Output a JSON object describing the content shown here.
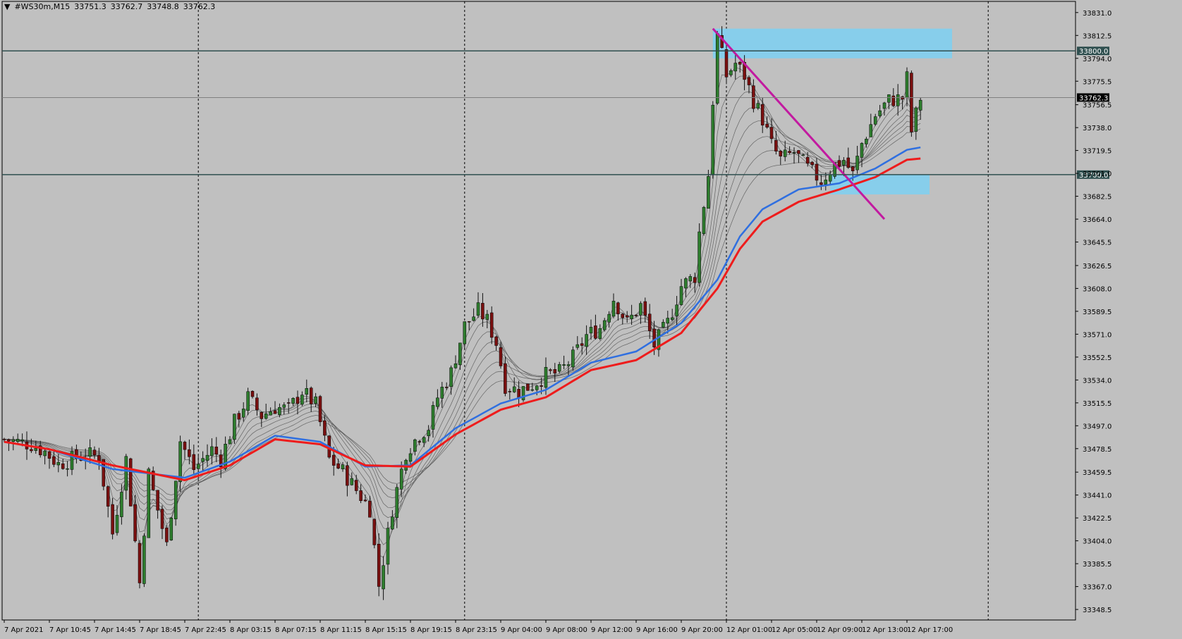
{
  "header": {
    "dropdown_icon": "triangle-down-icon",
    "symbol": "#WS30m,M15",
    "open": "33751.3",
    "high": "33762.7",
    "low": "33748.8",
    "close": "33762.3"
  },
  "colors": {
    "background": "#c0c0c0",
    "bull_candle": "#2e7d2e",
    "bear_candle": "#7a1010",
    "wick": "#111111",
    "ema_fast": "#2f6fe0",
    "ema_slow": "#ee1c1c",
    "ribbon": "#555555",
    "zone": "#87ceeb",
    "trendline": "#c21aa0",
    "hline": "#2f4f4f",
    "price_line": "#808080"
  },
  "chart_data": {
    "type": "candlestick",
    "symbol": "#WS30m",
    "timeframe": "M15",
    "ylim": [
      33340,
      33840
    ],
    "y_ticks": [
      "33831.0",
      "33812.5",
      "33794.0",
      "33775.5",
      "33756.5",
      "33738.0",
      "33719.5",
      "33701.0",
      "33682.5",
      "33664.0",
      "33645.5",
      "33626.5",
      "33608.0",
      "33589.5",
      "33571.0",
      "33552.5",
      "33534.0",
      "33515.5",
      "33497.0",
      "33478.5",
      "33459.5",
      "33441.0",
      "33422.5",
      "33404.0",
      "33385.5",
      "33367.0",
      "33348.5"
    ],
    "x_ticks": [
      "7 Apr 2021",
      "7 Apr 10:45",
      "7 Apr 14:45",
      "7 Apr 18:45",
      "7 Apr 22:45",
      "8 Apr 03:15",
      "8 Apr 07:15",
      "8 Apr 11:15",
      "8 Apr 15:15",
      "8 Apr 19:15",
      "8 Apr 23:15",
      "9 Apr 04:00",
      "9 Apr 08:00",
      "9 Apr 12:00",
      "9 Apr 16:00",
      "9 Apr 20:00",
      "12 Apr 01:00",
      "12 Apr 05:00",
      "12 Apr 09:00",
      "12 Apr 13:00",
      "12 Apr 17:00"
    ],
    "candles_count": 204,
    "close_path": [
      [
        0,
        33486
      ],
      [
        6,
        33482
      ],
      [
        9,
        33476
      ],
      [
        12,
        33466
      ],
      [
        18,
        33474
      ],
      [
        21,
        33472
      ],
      [
        24,
        33410
      ],
      [
        27,
        33470
      ],
      [
        30,
        33370
      ],
      [
        32,
        33458
      ],
      [
        36,
        33400
      ],
      [
        39,
        33485
      ],
      [
        42,
        33462
      ],
      [
        46,
        33478
      ],
      [
        48,
        33470
      ],
      [
        51,
        33500
      ],
      [
        54,
        33520
      ],
      [
        57,
        33505
      ],
      [
        60,
        33512
      ],
      [
        63,
        33510
      ],
      [
        66,
        33525
      ],
      [
        69,
        33514
      ],
      [
        72,
        33470
      ],
      [
        75,
        33460
      ],
      [
        78,
        33445
      ],
      [
        81,
        33430
      ],
      [
        83,
        33368
      ],
      [
        86,
        33430
      ],
      [
        89,
        33476
      ],
      [
        92,
        33490
      ],
      [
        94,
        33496
      ],
      [
        96,
        33520
      ],
      [
        99,
        33540
      ],
      [
        102,
        33578
      ],
      [
        105,
        33590
      ],
      [
        107,
        33582
      ],
      [
        109,
        33564
      ],
      [
        111,
        33530
      ],
      [
        114,
        33525
      ],
      [
        117,
        33530
      ],
      [
        120,
        33538
      ],
      [
        123,
        33540
      ],
      [
        126,
        33552
      ],
      [
        129,
        33570
      ],
      [
        132,
        33576
      ],
      [
        135,
        33600
      ],
      [
        138,
        33580
      ],
      [
        141,
        33594
      ],
      [
        144,
        33562
      ],
      [
        147,
        33580
      ],
      [
        150,
        33610
      ],
      [
        153,
        33618
      ],
      [
        154,
        33653
      ],
      [
        156,
        33700
      ],
      [
        157,
        33760
      ],
      [
        158,
        33812
      ],
      [
        160,
        33780
      ],
      [
        162,
        33790
      ],
      [
        164,
        33780
      ],
      [
        166,
        33760
      ],
      [
        168,
        33745
      ],
      [
        170,
        33724
      ],
      [
        172,
        33712
      ],
      [
        175,
        33718
      ],
      [
        178,
        33705
      ],
      [
        181,
        33695
      ],
      [
        184,
        33708
      ],
      [
        186,
        33712
      ],
      [
        188,
        33700
      ],
      [
        190,
        33725
      ],
      [
        193,
        33748
      ],
      [
        196,
        33760
      ],
      [
        199,
        33762
      ],
      [
        200,
        33778
      ],
      [
        201,
        33735
      ],
      [
        203,
        33762.3
      ]
    ],
    "ema_fast_path": [
      [
        0,
        33484
      ],
      [
        10,
        33478
      ],
      [
        24,
        33462
      ],
      [
        40,
        33455
      ],
      [
        50,
        33468
      ],
      [
        60,
        33489
      ],
      [
        70,
        33484
      ],
      [
        80,
        33464
      ],
      [
        90,
        33465
      ],
      [
        100,
        33495
      ],
      [
        110,
        33515
      ],
      [
        120,
        33526
      ],
      [
        130,
        33548
      ],
      [
        140,
        33557
      ],
      [
        150,
        33580
      ],
      [
        158,
        33615
      ],
      [
        163,
        33650
      ],
      [
        168,
        33672
      ],
      [
        176,
        33688
      ],
      [
        185,
        33693
      ],
      [
        193,
        33705
      ],
      [
        200,
        33720
      ],
      [
        203,
        33722
      ]
    ],
    "ema_slow_path": [
      [
        0,
        33484
      ],
      [
        10,
        33478
      ],
      [
        24,
        33465
      ],
      [
        40,
        33453
      ],
      [
        50,
        33465
      ],
      [
        60,
        33486
      ],
      [
        70,
        33482
      ],
      [
        80,
        33465
      ],
      [
        90,
        33464
      ],
      [
        100,
        33490
      ],
      [
        110,
        33510
      ],
      [
        120,
        33520
      ],
      [
        130,
        33542
      ],
      [
        140,
        33550
      ],
      [
        150,
        33572
      ],
      [
        158,
        33608
      ],
      [
        163,
        33640
      ],
      [
        168,
        33662
      ],
      [
        176,
        33678
      ],
      [
        185,
        33688
      ],
      [
        193,
        33698
      ],
      [
        200,
        33712
      ],
      [
        203,
        33713
      ]
    ],
    "horizontal_lines": [
      {
        "price": 33800.0,
        "label": "33800.0"
      },
      {
        "price": 33700.0,
        "label": "33700.0"
      }
    ],
    "current_price": {
      "price": 33762.3,
      "label": "33762.3"
    },
    "zones": [
      {
        "x_from": 157,
        "x_to": 210,
        "y_from": 33794,
        "y_to": 33818
      },
      {
        "x_from": 183,
        "x_to": 205,
        "y_from": 33684,
        "y_to": 33700
      }
    ],
    "trendline": {
      "from": [
        157,
        33818
      ],
      "to": [
        195,
        33664
      ]
    },
    "vertical_separators": [
      43,
      102,
      160,
      218
    ]
  }
}
